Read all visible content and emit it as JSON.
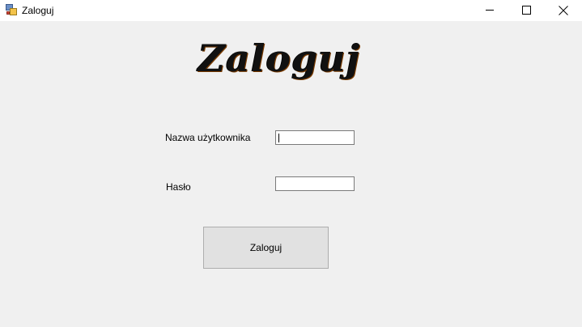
{
  "window": {
    "title": "Zaloguj",
    "icon": "windows-forms-app-icon",
    "controls": {
      "minimize": "minimize-icon",
      "maximize": "maximize-icon",
      "close": "close-icon"
    }
  },
  "header": {
    "logo_text": "Zaloguj"
  },
  "form": {
    "username_label": "Nazwa użytkownika",
    "username_value": "",
    "password_label": "Hasło",
    "password_value": "",
    "submit_label": "Zaloguj"
  }
}
